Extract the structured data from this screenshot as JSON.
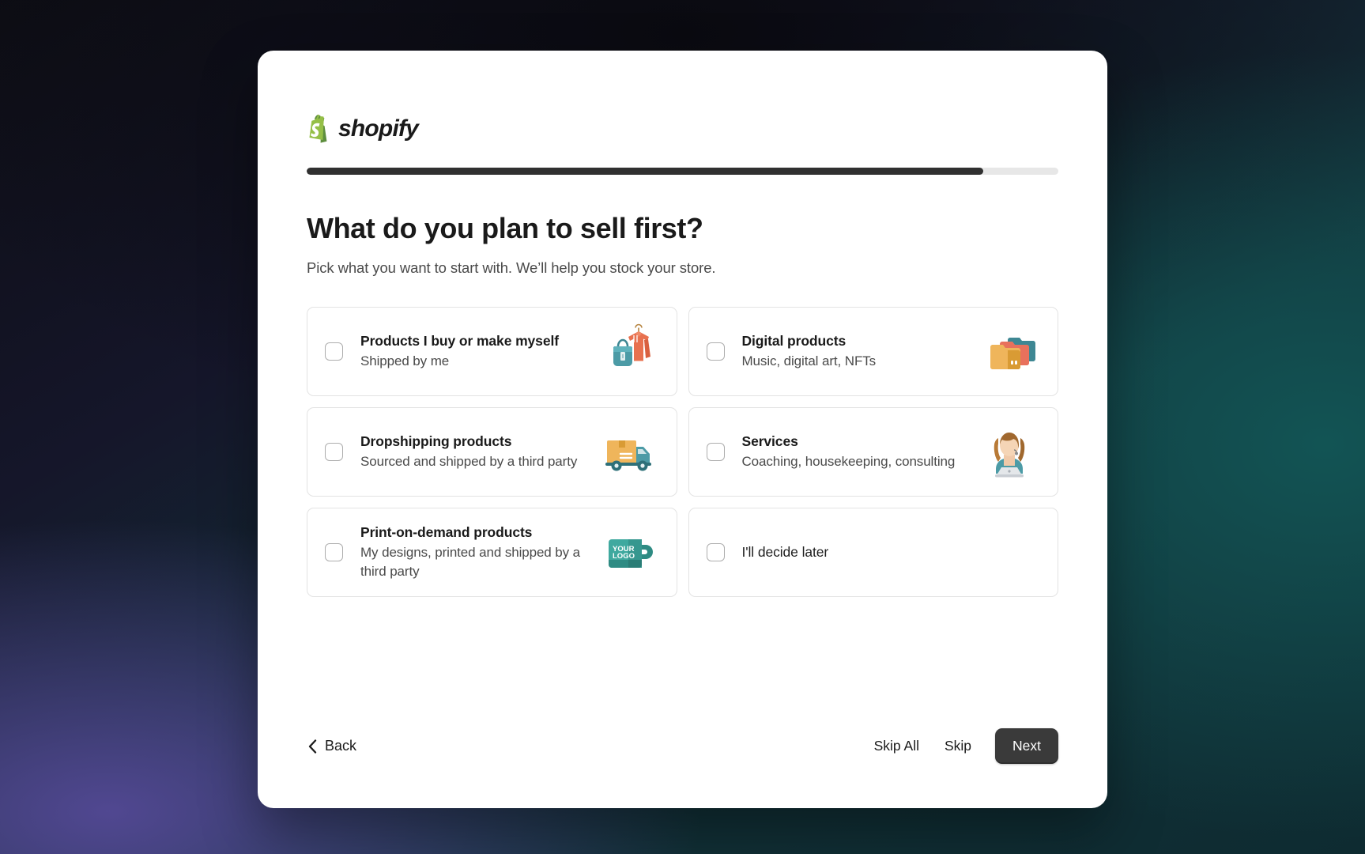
{
  "brand": {
    "logo_icon": "shopify-bag-icon",
    "name": "shopify"
  },
  "progress": {
    "percent": 90
  },
  "header": {
    "title": "What do you plan to sell first?",
    "subtitle": "Pick what you want to start with. We’ll help you stock your store."
  },
  "options": [
    {
      "title": "Products I buy or make myself",
      "desc": "Shipped by me",
      "icon": "handbag-and-hoodie-icon",
      "checked": false
    },
    {
      "title": "Digital products",
      "desc": "Music, digital art, NFTs",
      "icon": "folders-icon",
      "checked": false
    },
    {
      "title": "Dropshipping products",
      "desc": "Sourced and shipped by a third party",
      "icon": "delivery-truck-icon",
      "checked": false
    },
    {
      "title": "Services",
      "desc": "Coaching, housekeeping, consulting",
      "icon": "person-with-laptop-icon",
      "checked": false
    },
    {
      "title": "Print-on-demand products",
      "desc": "My designs, printed and shipped by a third party",
      "icon": "mug-with-logo-icon",
      "checked": false
    },
    {
      "title": "I'll decide later",
      "desc": "",
      "icon": "",
      "checked": false
    }
  ],
  "mug_label": {
    "line1": "YOUR",
    "line2": "LOGO"
  },
  "footer": {
    "back_label": "Back",
    "back_icon": "chevron-left-icon",
    "skip_all_label": "Skip All",
    "skip_label": "Skip",
    "next_label": "Next"
  },
  "colors": {
    "progress_fill": "#303030",
    "progress_track": "#e7e7e7",
    "next_button_bg": "#3a3a3a",
    "card_border": "#e3e3e3",
    "shopify_green": "#95BF47"
  }
}
